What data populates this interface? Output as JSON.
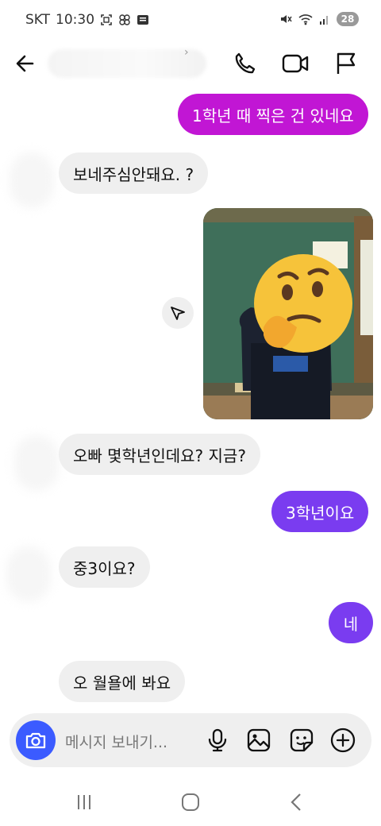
{
  "status_bar": {
    "carrier": "SKT",
    "time": "10:30",
    "battery": "28",
    "icons_left": [
      "screenshot-icon",
      "pinwheel-icon",
      "card-icon"
    ],
    "icons_right": [
      "mute-icon",
      "wifi-icon",
      "signal-icon",
      "battery-icon"
    ]
  },
  "header": {
    "back_icon": "arrow-left-icon",
    "actions": [
      "phone-icon",
      "video-icon",
      "flag-icon"
    ]
  },
  "messages": [
    {
      "side": "out",
      "text": "1학년 때 찍은 건 있네요",
      "color": "#c116d4"
    },
    {
      "side": "in",
      "text": "보네주심안돼요.  ?"
    },
    {
      "side": "out",
      "type": "photo"
    },
    {
      "side": "in",
      "text": "오빠 몇학년인데요? 지금?"
    },
    {
      "side": "out",
      "text": "3학년이요",
      "color": "#7a3cf0"
    },
    {
      "side": "in",
      "text": "중3이요?"
    },
    {
      "side": "out",
      "text": "네",
      "color": "#7a3cf0"
    },
    {
      "side": "in",
      "text": "오 월욜에 봐요"
    }
  ],
  "composer": {
    "placeholder": "메시지 보내기...",
    "accent": "#3b5bff",
    "tools": [
      "microphone-icon",
      "image-icon",
      "sticker-icon",
      "plus-circle-icon"
    ]
  },
  "nav": {
    "buttons": [
      "recents-icon",
      "home-icon",
      "back-icon"
    ]
  }
}
